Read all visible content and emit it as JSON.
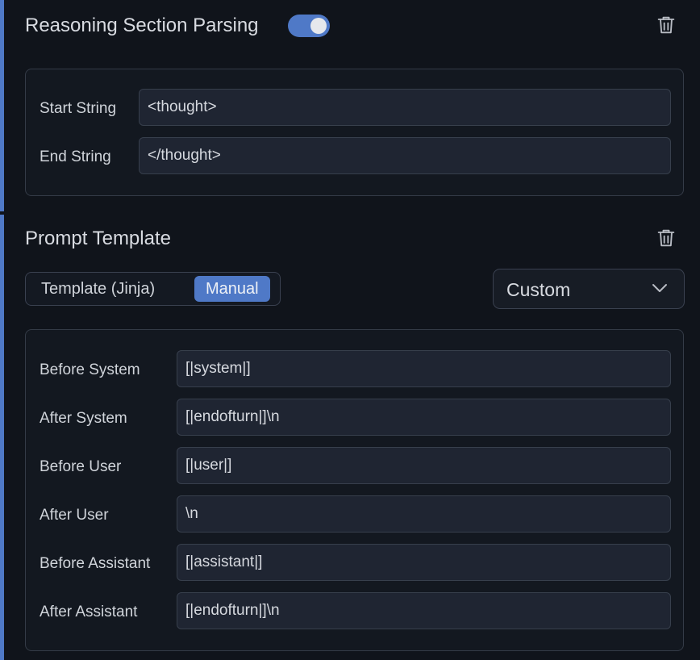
{
  "reasoning": {
    "title": "Reasoning Section Parsing",
    "enabled": true,
    "fields": [
      {
        "label": "Start String",
        "value": "<thought>"
      },
      {
        "label": "End String",
        "value": "</thought>"
      }
    ]
  },
  "prompt_template": {
    "title": "Prompt Template",
    "mode_options": [
      "Template (Jinja)",
      "Manual"
    ],
    "selected_mode": "Manual",
    "preset": "Custom",
    "fields": [
      {
        "label": "Before System",
        "value": "[|system|]"
      },
      {
        "label": "After System",
        "value": "[|endofturn|]\\n"
      },
      {
        "label": "Before User",
        "value": "[|user|]"
      },
      {
        "label": "After User",
        "value": "\\n"
      },
      {
        "label": "Before Assistant",
        "value": "[|assistant|]"
      },
      {
        "label": "After Assistant",
        "value": "[|endofturn|]\\n"
      }
    ]
  },
  "icons": {
    "delete": "trash-icon",
    "dropdown": "chevron-down-icon"
  },
  "colors": {
    "accent": "#4f79c7",
    "background": "#10141b",
    "field_bg": "#1f2532",
    "border": "#343b47"
  }
}
